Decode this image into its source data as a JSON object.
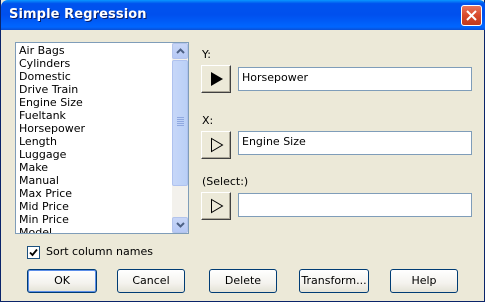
{
  "window": {
    "title": "Simple Regression"
  },
  "columns_list": {
    "items": [
      "Air Bags",
      "Cylinders",
      "Domestic",
      "Drive Train",
      "Engine Size",
      "Fueltank",
      "Horsepower",
      "Length",
      "Luggage",
      "Make",
      "Manual",
      "Max Price",
      "Mid Price",
      "Min Price",
      "Model"
    ]
  },
  "fields": {
    "y": {
      "label": "Y:",
      "value": "Horsepower"
    },
    "x": {
      "label": "X:",
      "value": "Engine Size"
    },
    "select": {
      "label": "(Select:)",
      "value": ""
    }
  },
  "options": {
    "sort_label": "Sort column names",
    "sort_checked": true
  },
  "buttons": {
    "ok": "OK",
    "cancel": "Cancel",
    "delete": "Delete",
    "transform": "Transform...",
    "help": "Help"
  },
  "colors": {
    "titlebar": "#0053ee",
    "close": "#d84a2b",
    "dialog_bg": "#ece9d8",
    "field_border": "#7f9db9"
  }
}
